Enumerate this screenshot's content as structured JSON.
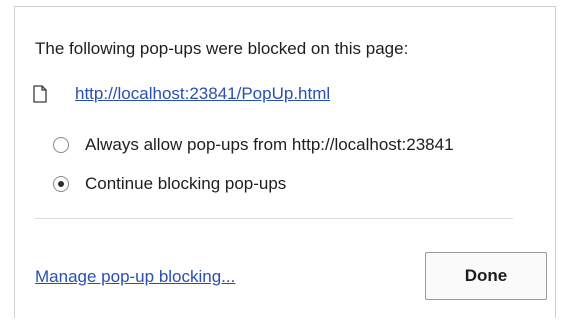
{
  "dialog": {
    "heading": "The following pop-ups were blocked on this page:",
    "blocked_url": "http://localhost:23841/PopUp.html",
    "options": [
      {
        "label": "Always allow pop-ups from http://localhost:23841",
        "checked": false
      },
      {
        "label": "Continue blocking pop-ups",
        "checked": true
      }
    ],
    "manage_link": "Manage pop-up blocking...",
    "done_label": "Done"
  },
  "icons": {
    "page": "page-icon"
  },
  "colors": {
    "link": "#2a4fb0",
    "text": "#1e1e1e",
    "border": "#cfcfcf"
  }
}
